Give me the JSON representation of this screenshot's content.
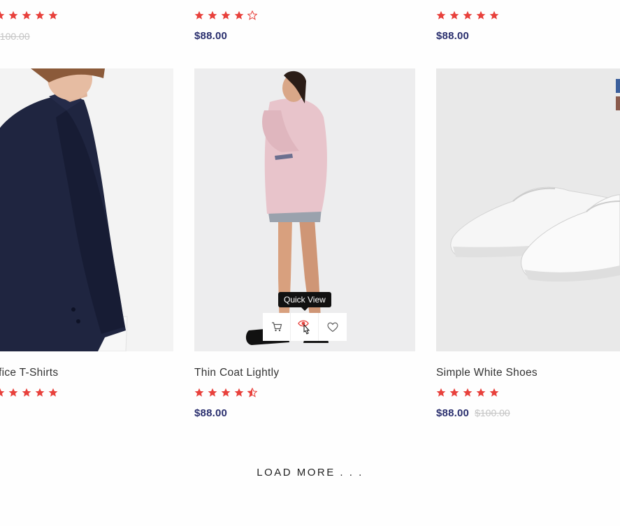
{
  "top_row": [
    {
      "price": "",
      "old_price": "$100.00",
      "rating": 5
    },
    {
      "price": "$88.00",
      "old_price": "",
      "rating": 4
    },
    {
      "price": "$88.00",
      "old_price": "",
      "rating": 5
    }
  ],
  "products": [
    {
      "title": "fice T-Shirts",
      "price": "",
      "old_price": "",
      "rating": 5,
      "image_icon": "man-navy-shirt-image"
    },
    {
      "title": "Thin Coat Lightly",
      "price": "$88.00",
      "old_price": "",
      "rating": 4.5,
      "image_icon": "woman-pink-coat-image"
    },
    {
      "title": "Simple White Shoes",
      "price": "$88.00",
      "old_price": "$100.00",
      "rating": 5,
      "image_icon": "white-sneakers-image"
    }
  ],
  "quick_actions": {
    "tooltip": "Quick View",
    "icons": [
      "cart-icon",
      "eye-icon",
      "heart-icon"
    ]
  },
  "load_more": "LOAD MORE . . .",
  "colors": {
    "star": "#e8413c",
    "price": "#2a2f6e",
    "old_price": "#c4c4c4",
    "swatch_blue": "#3b5f9c",
    "swatch_brown": "#8a5a4c"
  }
}
